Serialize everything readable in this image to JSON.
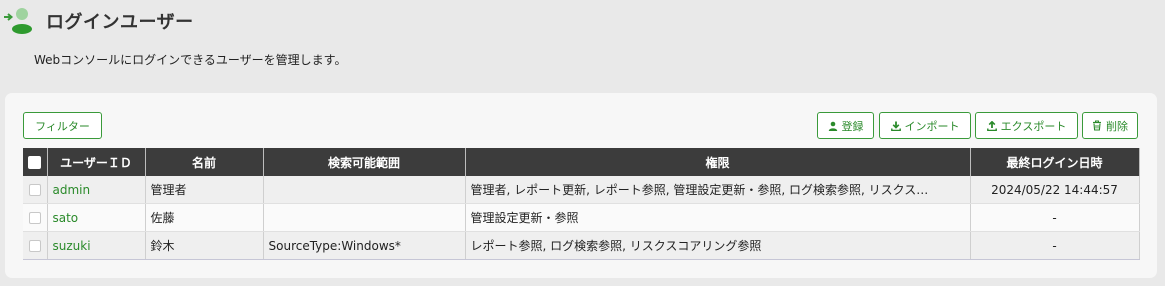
{
  "header": {
    "title": "ログインユーザー",
    "icon": "user-login-icon",
    "description": "Webコンソールにログインできるユーザーを管理します。"
  },
  "toolbar": {
    "filter_label": "フィルター",
    "register_label": "登録",
    "import_label": "インポート",
    "export_label": "エクスポート",
    "delete_label": "削除"
  },
  "table": {
    "columns": [
      "ユーザーＩＤ",
      "名前",
      "検索可能範囲",
      "権限",
      "最終ログイン日時"
    ],
    "rows": [
      {
        "user_id": "admin",
        "name": "管理者",
        "search_scope": "",
        "permissions": "管理者, レポート更新, レポート参照, 管理設定更新・参照, ログ検索参照, リスクス…",
        "last_login": "2024/05/22 14:44:57"
      },
      {
        "user_id": "sato",
        "name": "佐藤",
        "search_scope": "",
        "permissions": "管理設定更新・参照",
        "last_login": "-"
      },
      {
        "user_id": "suzuki",
        "name": "鈴木",
        "search_scope": "SourceType:Windows*",
        "permissions": "レポート参照, ログ検索参照, リスクスコアリング参照",
        "last_login": "-"
      }
    ]
  },
  "colors": {
    "accent": "#2a8a2a",
    "header_bg": "#3c3c3c",
    "page_bg": "#e9e9e9"
  }
}
